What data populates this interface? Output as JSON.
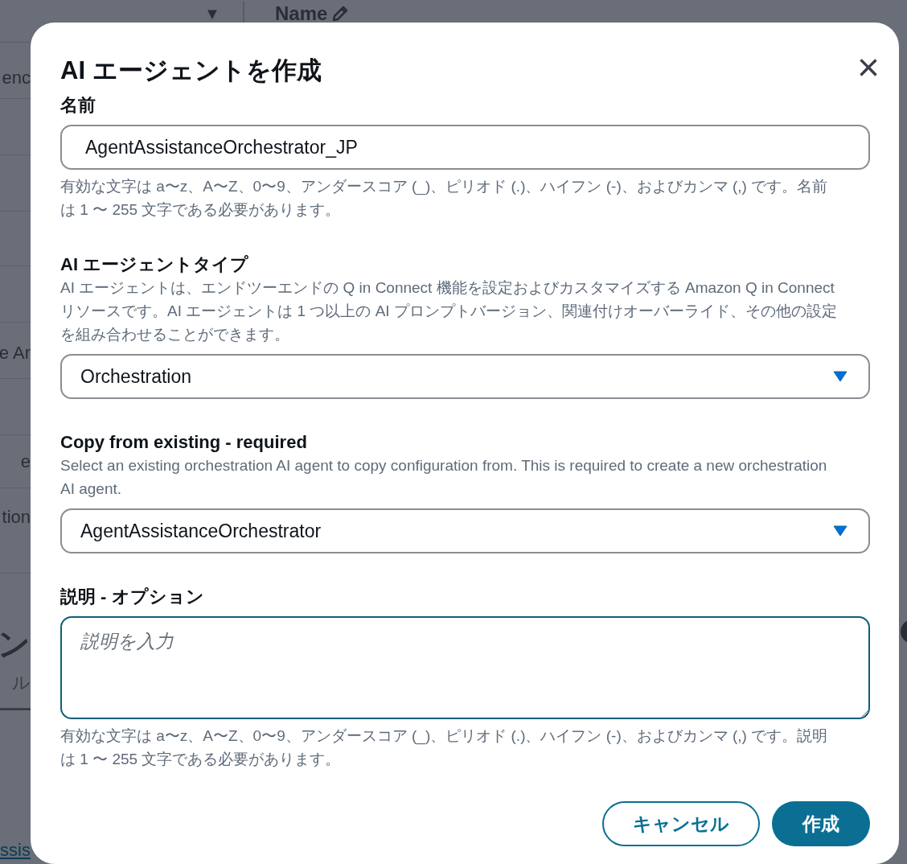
{
  "background": {
    "filter_icon": "▼",
    "column_header": "Name",
    "fragments": [
      "enc",
      "e Ar",
      "e",
      "tion"
    ],
    "heading_fragment": "ン",
    "subtext_fragment": "ル",
    "link_fragment": "ssis"
  },
  "dialog": {
    "title": "AI エージェントを作成",
    "close": "×",
    "fields": [
      {
        "kind": "input",
        "label": "名前",
        "value": "AgentAssistanceOrchestrator_JP",
        "help": "有効な文字は a〜z、A〜Z、0〜9、アンダースコア (_)、ピリオド (.)、ハイフン (-)、およびカンマ (,) です。名前は 1 〜 255 文字である必要があります。",
        "focused": false
      },
      {
        "kind": "select",
        "label": "AI エージェントタイプ",
        "description": "AI エージェントは、エンドツーエンドの Q in Connect 機能を設定およびカスタマイズする Amazon Q in Connect リソースです。AI エージェントは 1 つ以上の AI プロンプトバージョン、関連付けオーバーライド、その他の設定を組み合わせることができます。",
        "value": "Orchestration",
        "focused": false
      },
      {
        "kind": "select",
        "label": "Copy from existing - required",
        "description": "Select an existing orchestration AI agent to copy configuration from. This is required to create a new orchestration AI agent.",
        "value": "AgentAssistanceOrchestrator",
        "focused": false
      },
      {
        "kind": "textarea",
        "label": "説明 - オプション",
        "placeholder": "説明を入力",
        "help": "有効な文字は a〜z、A〜Z、0〜9、アンダースコア (_)、ピリオド (.)、ハイフン (-)、およびカンマ (,) です。説明は 1 〜 255 文字である必要があります。",
        "focused": true
      }
    ],
    "buttons": [
      {
        "label": "キャンセル",
        "kind": "secondary"
      },
      {
        "label": "作成",
        "kind": "primary"
      }
    ]
  }
}
